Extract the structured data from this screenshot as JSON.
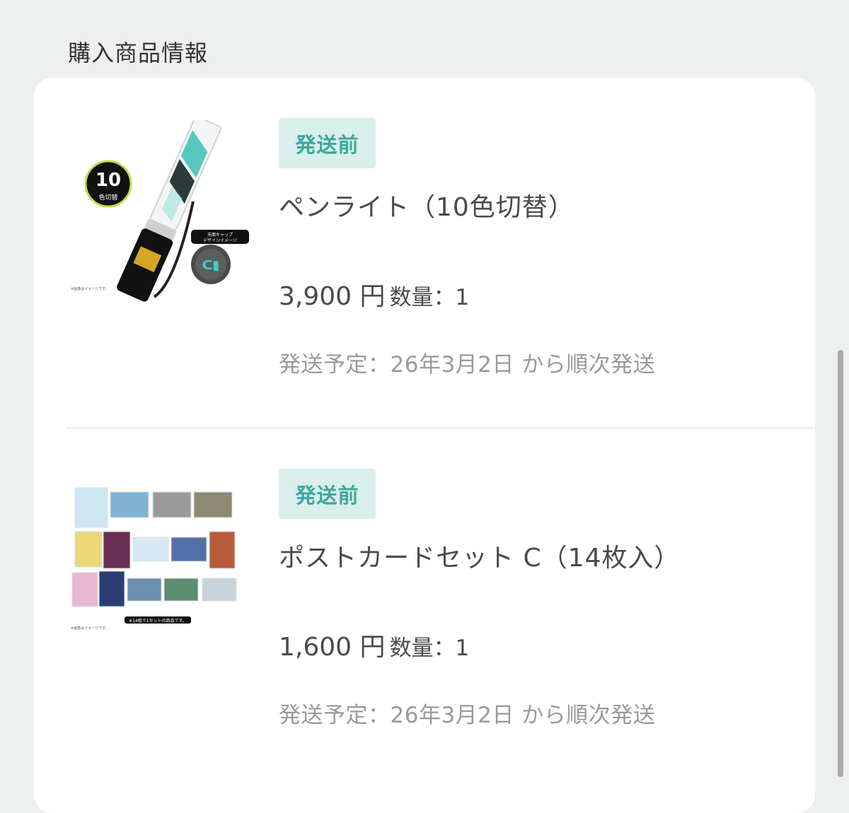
{
  "section": {
    "title": "購入商品情報"
  },
  "items": [
    {
      "status": "発送前",
      "name": "ペンライト（10色切替）",
      "price": "3,900 円",
      "quantity": "数量：1",
      "shipping": "発送予定：26年3月2日 から順次発送",
      "thumb": {
        "badge_number": "10",
        "badge_text": "色切替",
        "cap_label_1": "天面キャップ",
        "cap_label_2": "デザインイメージ",
        "note": "※画像はイメージです。"
      }
    },
    {
      "status": "発送前",
      "name": "ポストカードセット C（14枚入）",
      "price": "1,600 円",
      "quantity": "数量：1",
      "shipping": "発送予定：26年3月2日 から順次発送",
      "thumb": {
        "caption": "※14枚で1セットの商品です。",
        "note": "※画像はイメージです。"
      }
    }
  ],
  "colors": {
    "badge_bg": "#d8efec",
    "badge_text": "#3fa79d",
    "page_bg": "#eef0ef"
  }
}
